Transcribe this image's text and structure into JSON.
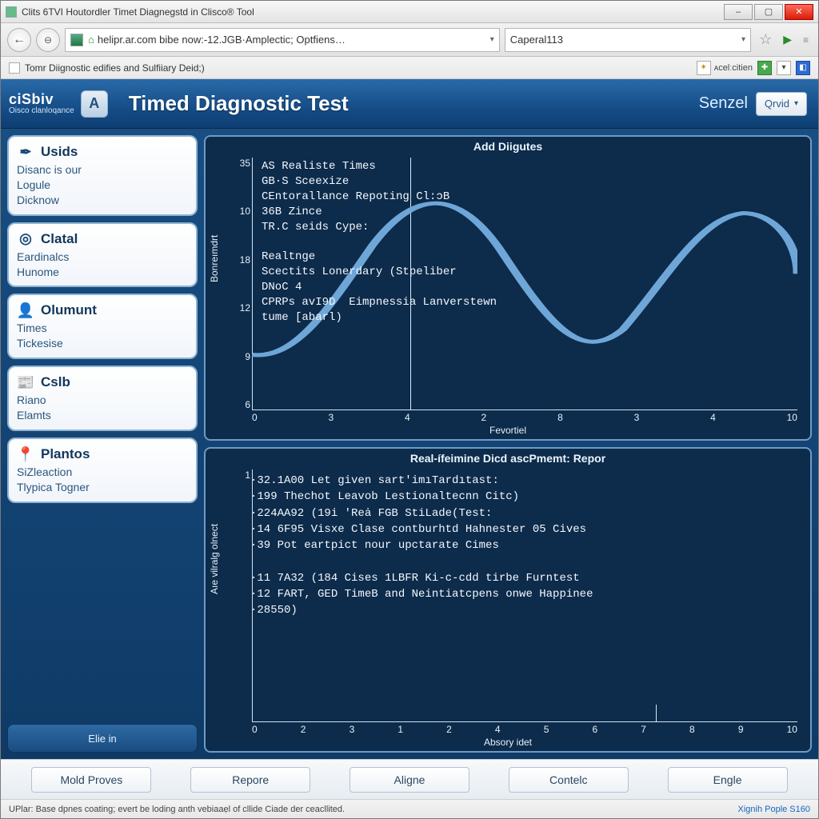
{
  "window": {
    "title": "Clits 6TVI Houtordler Timet Diagnegstd in Clisco® Tool"
  },
  "nav": {
    "url_display": "helipr.ar.com bibe now:-12.JGB·Amplectic; Optfiens…",
    "search_value": "Caperal113"
  },
  "tabs": {
    "active": "Tomr Diignostic edifies and Sulfiiary Deid;)",
    "ext_label": "ᴀcelːcitien"
  },
  "header": {
    "brand_top": "ciSbiv",
    "brand_sub": "Oisco clanloqance",
    "title": "Timed Diagnostic Test",
    "right_label": "Senzel",
    "dropdown": "Qrvid"
  },
  "sidebar": {
    "items": [
      {
        "title": "Usids",
        "sub": "Disanc is our\nLogule\nDicknow",
        "icon": "✒"
      },
      {
        "title": "Clatal",
        "sub": "Eardinalcs\nHunome",
        "icon": "◎"
      },
      {
        "title": "Olumunt",
        "sub": "Times\nTickesise",
        "icon": "👤"
      },
      {
        "title": "Cslb",
        "sub": "Riano\nElamts",
        "icon": "📰"
      },
      {
        "title": "Plantos",
        "sub": "SiZleaction\nTlypica Togner",
        "icon": "📍"
      }
    ],
    "signin": "Elie in"
  },
  "chart_data": [
    {
      "type": "line",
      "title": "Add Diigutes",
      "ylabel": "Bonreımdrt",
      "xlabel": "Fevortiel",
      "yticks": [
        "35",
        "10",
        "18",
        "12",
        "9",
        "6"
      ],
      "xticks": [
        "0",
        "3",
        "4",
        "2",
        "8",
        "3",
        "4",
        "10"
      ],
      "overlay_lines": [
        "AS Realiste Times",
        "GB·S Sceexize",
        "CEntorallance Repoting Cl:ɔB",
        "36B Zince",
        "TR.C seids Cype:",
        "",
        "Realtnge",
        "Scectits Lonerdary (Stpeliber",
        "DNoC 4",
        "CPRPs avI9D  Eimpnessia Lanverstewn",
        "tume [abarl)"
      ]
    },
    {
      "type": "line",
      "title": "Real-ífeimine Dicd ascPmemt: Repor",
      "ylabel": "Aıe vilralg olnect",
      "xlabel": "Absory idet",
      "yticks": [
        "1"
      ],
      "xticks": [
        "0",
        "2",
        "3",
        "1",
        "2",
        "4",
        "5",
        "6",
        "7",
        "8",
        "9",
        "10"
      ],
      "overlay_lines": [
        "·32.1A00 Let given sart'imıTardıtast:",
        "·199 Thechot Leavob Lestionaltecnn Citc)",
        "·224AA92 (19i 'Reȧ FGB StiLade(Test:",
        "·14 6F95 Visxe Clase contburhtd Hahnester 05 Cives",
        "·39 Pot eartpict nour upctarate Cimes",
        "",
        "·11 7A32 (184 Cises 1LBFR Ki-c-cdd tirbe Furntest",
        "·12 FART, GED TimeB and Neintiatcpens onwe Happinee",
        "·28550)"
      ]
    }
  ],
  "buttons": [
    "Mold Proves",
    "Repore",
    "Aligne",
    "Contelc",
    "Engle"
  ],
  "status": {
    "left": "UPlar: Base dpnes coating; evert be loding anth vebiaaẹl of cllide Ciade der ceacllited.",
    "right": "Xignih Pople S160"
  }
}
